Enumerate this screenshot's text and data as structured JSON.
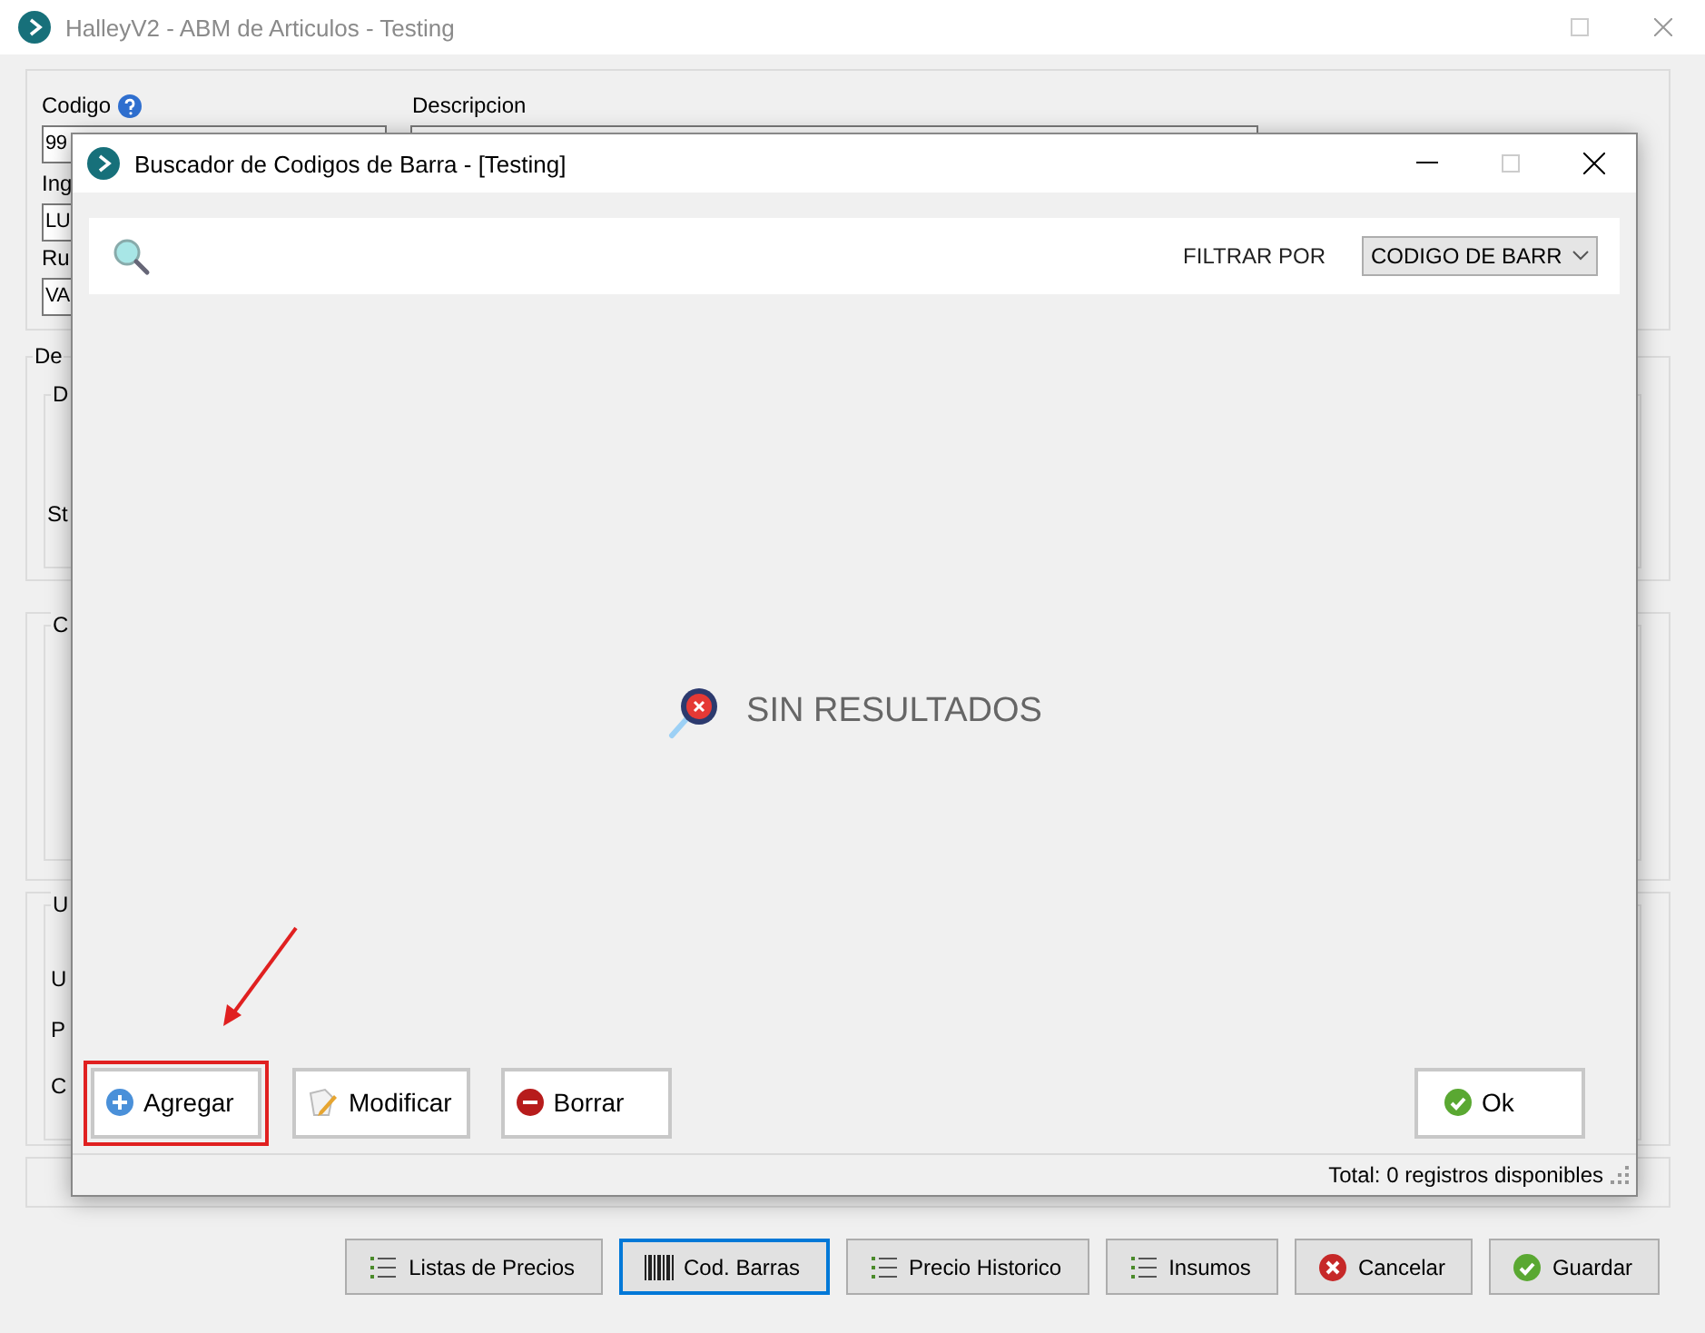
{
  "main_window": {
    "title": "HalleyV2 - ABM de Articulos - Testing"
  },
  "form": {
    "code_label": "Codigo",
    "code_value": "99",
    "description_label": "Descripcion",
    "fields": [
      {
        "label": "Ing",
        "value": "LU"
      },
      {
        "label": "Ru",
        "value": "VA"
      }
    ]
  },
  "section_1": {
    "legend": "De",
    "inner_legend": "D",
    "label": "St"
  },
  "section_2": {
    "legend": "C"
  },
  "section_3": {
    "legend": "U",
    "labels": [
      "U",
      "P",
      "C"
    ]
  },
  "bottom_buttons": [
    {
      "label": "Listas de Precios",
      "focused": false
    },
    {
      "label": "Cod. Barras",
      "focused": true
    },
    {
      "label": "Precio Historico",
      "focused": false
    },
    {
      "label": "Insumos",
      "focused": false
    },
    {
      "label": "Cancelar",
      "focused": false
    },
    {
      "label": "Guardar",
      "focused": false
    }
  ],
  "dialog": {
    "title": "Buscador de Codigos de Barra - [Testing]",
    "filter_label": "FILTRAR POR",
    "filter_value": "CODIGO DE BARR",
    "empty_message": "SIN RESULTADOS",
    "actions": [
      {
        "label": "Agregar",
        "highlighted": true
      },
      {
        "label": "Modificar",
        "highlighted": false
      },
      {
        "label": "Borrar",
        "highlighted": false
      }
    ],
    "confirm": {
      "label": "Ok"
    },
    "status": "Total: 0 registros disponibles"
  }
}
